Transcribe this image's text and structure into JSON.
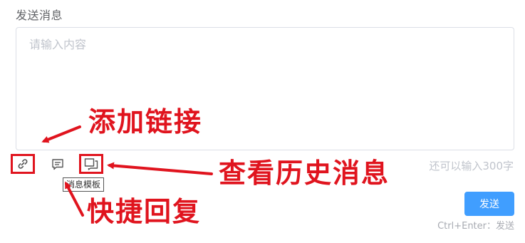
{
  "form": {
    "title": "发送消息",
    "placeholder": "请输入内容",
    "counter": "还可以输入300字"
  },
  "toolbar": {
    "link_icon": "link-icon",
    "template_icon": "message-template-icon",
    "history_icon": "history-messages-icon",
    "tooltip": "消息模板"
  },
  "actions": {
    "send_label": "发送",
    "shortcut_hint": "Ctrl+Enter：发送"
  },
  "annotations": {
    "add_link": "添加链接",
    "view_history": "查看历史消息",
    "quick_reply": "快捷回复",
    "color": "#e0141e"
  },
  "colors": {
    "primary": "#409eff",
    "border": "#dcdfe6",
    "placeholder": "#c0c4cc"
  }
}
